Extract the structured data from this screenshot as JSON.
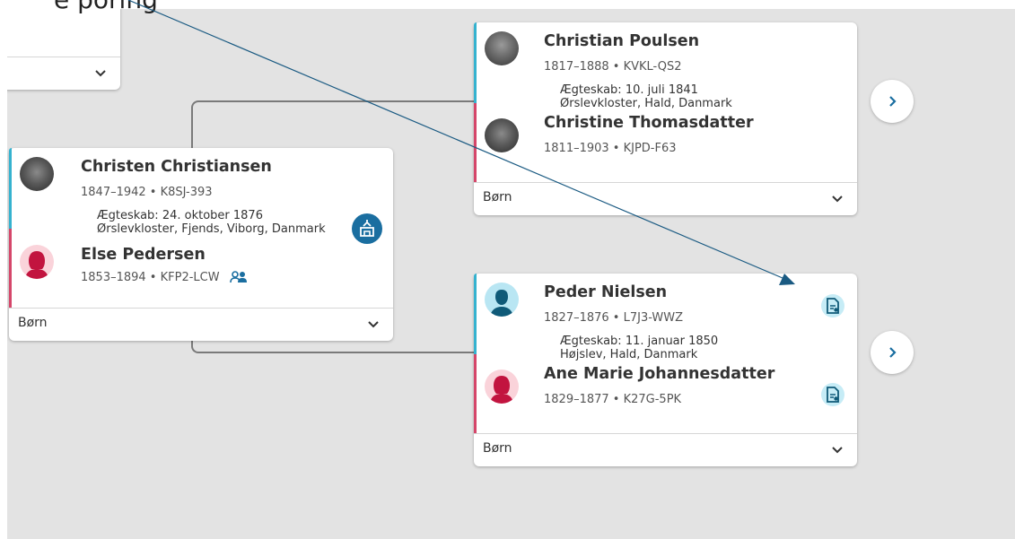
{
  "heading": {
    "visible_text": "e poring"
  },
  "couples": [
    {
      "husband": {
        "name": "Christen Christiansen",
        "dates": "1847–1942 • K8SJ-393"
      },
      "marriage": {
        "line1": "Ægteskab: 24. oktober 1876",
        "line2": "Ørslevkloster, Fjends, Viborg, Danmark"
      },
      "wife": {
        "name": "Else Pedersen",
        "dates": "1853–1894 • KFP2-LCW"
      },
      "children_label": "Børn"
    },
    {
      "husband": {
        "name": "Christian Poulsen",
        "dates": "1817–1888 • KVKL-QS2"
      },
      "marriage": {
        "line1": "Ægteskab: 10. juli 1841",
        "line2": "Ørslevkloster, Hald, Danmark"
      },
      "wife": {
        "name": "Christine Thomasdatter",
        "dates": "1811–1903 • KJPD-F63"
      },
      "children_label": "Børn"
    },
    {
      "husband": {
        "name": "Peder Nielsen",
        "dates": "1827–1876 • L7J3-WWZ"
      },
      "marriage": {
        "line1": "Ægteskab: 11. januar 1850",
        "line2": "Højslev, Hald, Danmark"
      },
      "wife": {
        "name": "Ane Marie Johannesdatter",
        "dates": "1829–1877 • K27G-5PK"
      },
      "children_label": "Børn"
    }
  ],
  "icons": {
    "expand": "chevron-down-icon",
    "next_generation": "chevron-right-icon",
    "record_hint": "record-hint-icon",
    "temple": "temple-icon",
    "relationship": "persons-icon"
  },
  "colors": {
    "male": "#35b2cf",
    "female": "#d5466a",
    "accent": "#1a6ea0",
    "canvas_bg": "#e3e3e3",
    "annotation_arrow": "#1a5a82"
  }
}
